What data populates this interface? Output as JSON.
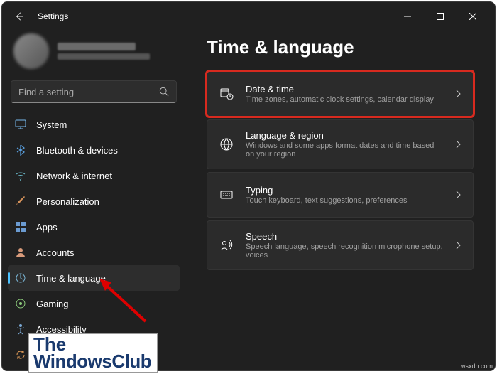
{
  "window": {
    "title": "Settings"
  },
  "search": {
    "placeholder": "Find a setting"
  },
  "nav": {
    "items": [
      {
        "label": "System"
      },
      {
        "label": "Bluetooth & devices"
      },
      {
        "label": "Network & internet"
      },
      {
        "label": "Personalization"
      },
      {
        "label": "Apps"
      },
      {
        "label": "Accounts"
      },
      {
        "label": "Time & language"
      },
      {
        "label": "Gaming"
      },
      {
        "label": "Accessibility"
      },
      {
        "label": "Windows Update"
      }
    ]
  },
  "page": {
    "title": "Time & language"
  },
  "cards": [
    {
      "title": "Date & time",
      "sub": "Time zones, automatic clock settings, calendar display"
    },
    {
      "title": "Language & region",
      "sub": "Windows and some apps format dates and time based on your region"
    },
    {
      "title": "Typing",
      "sub": "Touch keyboard, text suggestions, preferences"
    },
    {
      "title": "Speech",
      "sub": "Speech language, speech recognition microphone setup, voices"
    }
  ],
  "watermark": {
    "line1": "The",
    "line2": "WindowsClub",
    "site": "wsxdn.com"
  }
}
